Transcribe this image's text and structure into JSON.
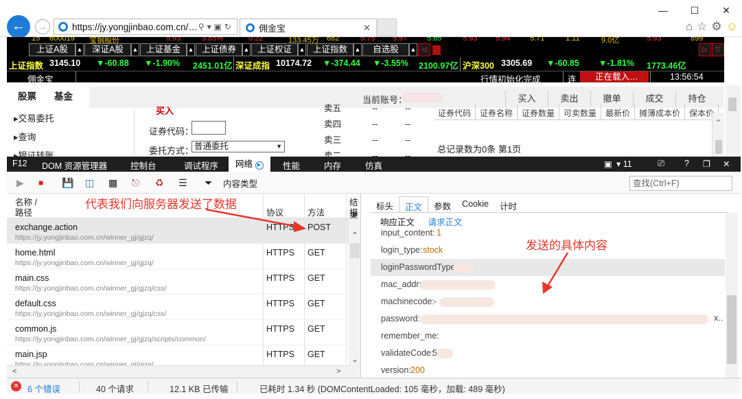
{
  "browser": {
    "url": "https://jy.yongjinbao.com.cn/…",
    "tab_title": "佣金宝",
    "window_controls": [
      "—",
      "☐",
      "✕"
    ]
  },
  "ticker": {
    "row0": [
      "15",
      "600019",
      "宝钢股份",
      "5.93",
      "3.85%",
      "0.22",
      "133.45万",
      "682",
      "5.75",
      "5.97",
      "5.65",
      "5.93",
      "5.94",
      "5.71",
      "1.11",
      "9.0亿",
      "5.93",
      "899"
    ],
    "tabs": [
      "上证A股",
      "深证A股",
      "上证基金",
      "上证债券",
      "上证权证",
      "上证指数",
      "自选股"
    ],
    "sh_label": "上证指数",
    "sh_value": "3145.10",
    "sh_change": "▼-60.88",
    "sh_pct": "▼-1.90%",
    "sh_amount": "2451.01亿",
    "sz_label": "深证成指",
    "sz_value": "10174.72",
    "sz_change": "▼-374.44",
    "sz_pct": "▼-3.55%",
    "sz_amount": "2100.97亿",
    "hs_label": "沪深300",
    "hs_value": "3305.69",
    "hs_change": "▼-60.85",
    "hs_pct": "▼-1.81%",
    "hs_amount": "1773.46亿",
    "status_app": "佣金宝",
    "status_init": "行情初始化完成",
    "status_conn": "连",
    "status_loading": "正在载入…",
    "status_time": "13:56:54"
  },
  "page": {
    "tab_stock": "股票",
    "tab_fund": "基金",
    "account_label": "当前账号：",
    "actions": [
      "买入",
      "卖出",
      "撤单",
      "成交",
      "持仓"
    ],
    "nav": [
      "▸交易委托",
      "▸查询",
      "▸银证转账"
    ],
    "buy_label": "买入",
    "code_label": "证券代码：",
    "method_label": "委托方式：",
    "method_value": "普通委托",
    "book": [
      {
        "l": "卖五",
        "p": "--",
        "v": "--"
      },
      {
        "l": "卖四",
        "p": "--",
        "v": "--"
      },
      {
        "l": "卖三",
        "p": "--",
        "v": "--"
      },
      {
        "l": "卖二",
        "p": "--",
        "v": "--"
      }
    ],
    "grid_headers": [
      "证券代码",
      "证券名称",
      "证券数量",
      "可卖数量",
      "最新价",
      "摊薄成本价",
      "保本价"
    ],
    "total": "总记录数为0条 第1页"
  },
  "devtools": {
    "tabs": [
      "F12",
      "DOM 资源管理器",
      "控制台",
      "调试程序",
      "网络",
      "性能",
      "内存",
      "仿真"
    ],
    "active_tab": "网络",
    "right": {
      "screen": "▾ 11",
      "help": "?",
      "close": "✕"
    },
    "toolbar_label": "内容类型",
    "find_placeholder": "查找(Ctrl+F)",
    "list_headers": {
      "name": "名称 /",
      "path": "路径",
      "protocol": "协议",
      "method": "方法",
      "result": "结果",
      "desc": "描"
    },
    "requests": [
      {
        "name": "exchange.action",
        "url": "https://jy.yongjinbao.com.cn/winner_gj/gjzq/",
        "protocol": "HTTPS",
        "method": "POST"
      },
      {
        "name": "home.html",
        "url": "https://jy.yongjinbao.com.cn/winner_gj/gjzq/",
        "protocol": "HTTPS",
        "method": "GET"
      },
      {
        "name": "main.css",
        "url": "https://jy.yongjinbao.com.cn/winner_gj/gjzq/css/",
        "protocol": "HTTPS",
        "method": "GET"
      },
      {
        "name": "default.css",
        "url": "https://jy.yongjinbao.com.cn/winner_gj/gjzq/css/",
        "protocol": "HTTPS",
        "method": "GET"
      },
      {
        "name": "common.js",
        "url": "https://jy.yongjinbao.com.cn/winner_gj/gjzq/scripts/common/",
        "protocol": "HTTPS",
        "method": "GET"
      },
      {
        "name": "main.jsp",
        "url": "https://jy.yongjinbao.com.cn/winner_gj/gjzq/",
        "protocol": "HTTPS",
        "method": "GET"
      }
    ],
    "detail_tabs": [
      "标头",
      "正文",
      "参数",
      "Cookie",
      "计时"
    ],
    "active_detail_tab": "正文",
    "sub_tabs": {
      "response": "响应正文",
      "request": "请求正文"
    },
    "fields": [
      {
        "k": "input_content:",
        "v": "1"
      },
      {
        "k": "login_type:",
        "v": "stock"
      },
      {
        "k": "loginPasswordType:",
        "v": ""
      },
      {
        "k": "mac_addr:",
        "v": ""
      },
      {
        "k": "machinecode:",
        "v": "-"
      },
      {
        "k": "password:",
        "v": ""
      },
      {
        "k": "remember_me:",
        "v": ""
      },
      {
        "k": "validateCode:",
        "v": "5"
      },
      {
        "k": "version:",
        "v": "200"
      }
    ],
    "status": {
      "errors": "6 个错误",
      "requests": "40 个请求",
      "transferred": "12.1 KB 已传输",
      "timing": "已耗时 1.34 秒 (DOMContentLoaded: 105 毫秒，加载: 489 毫秒)"
    }
  },
  "annotations": {
    "post_note": "代表我们向服务器发送了数据",
    "content_note": "发送的具体内容",
    "color": "#e8362a"
  }
}
